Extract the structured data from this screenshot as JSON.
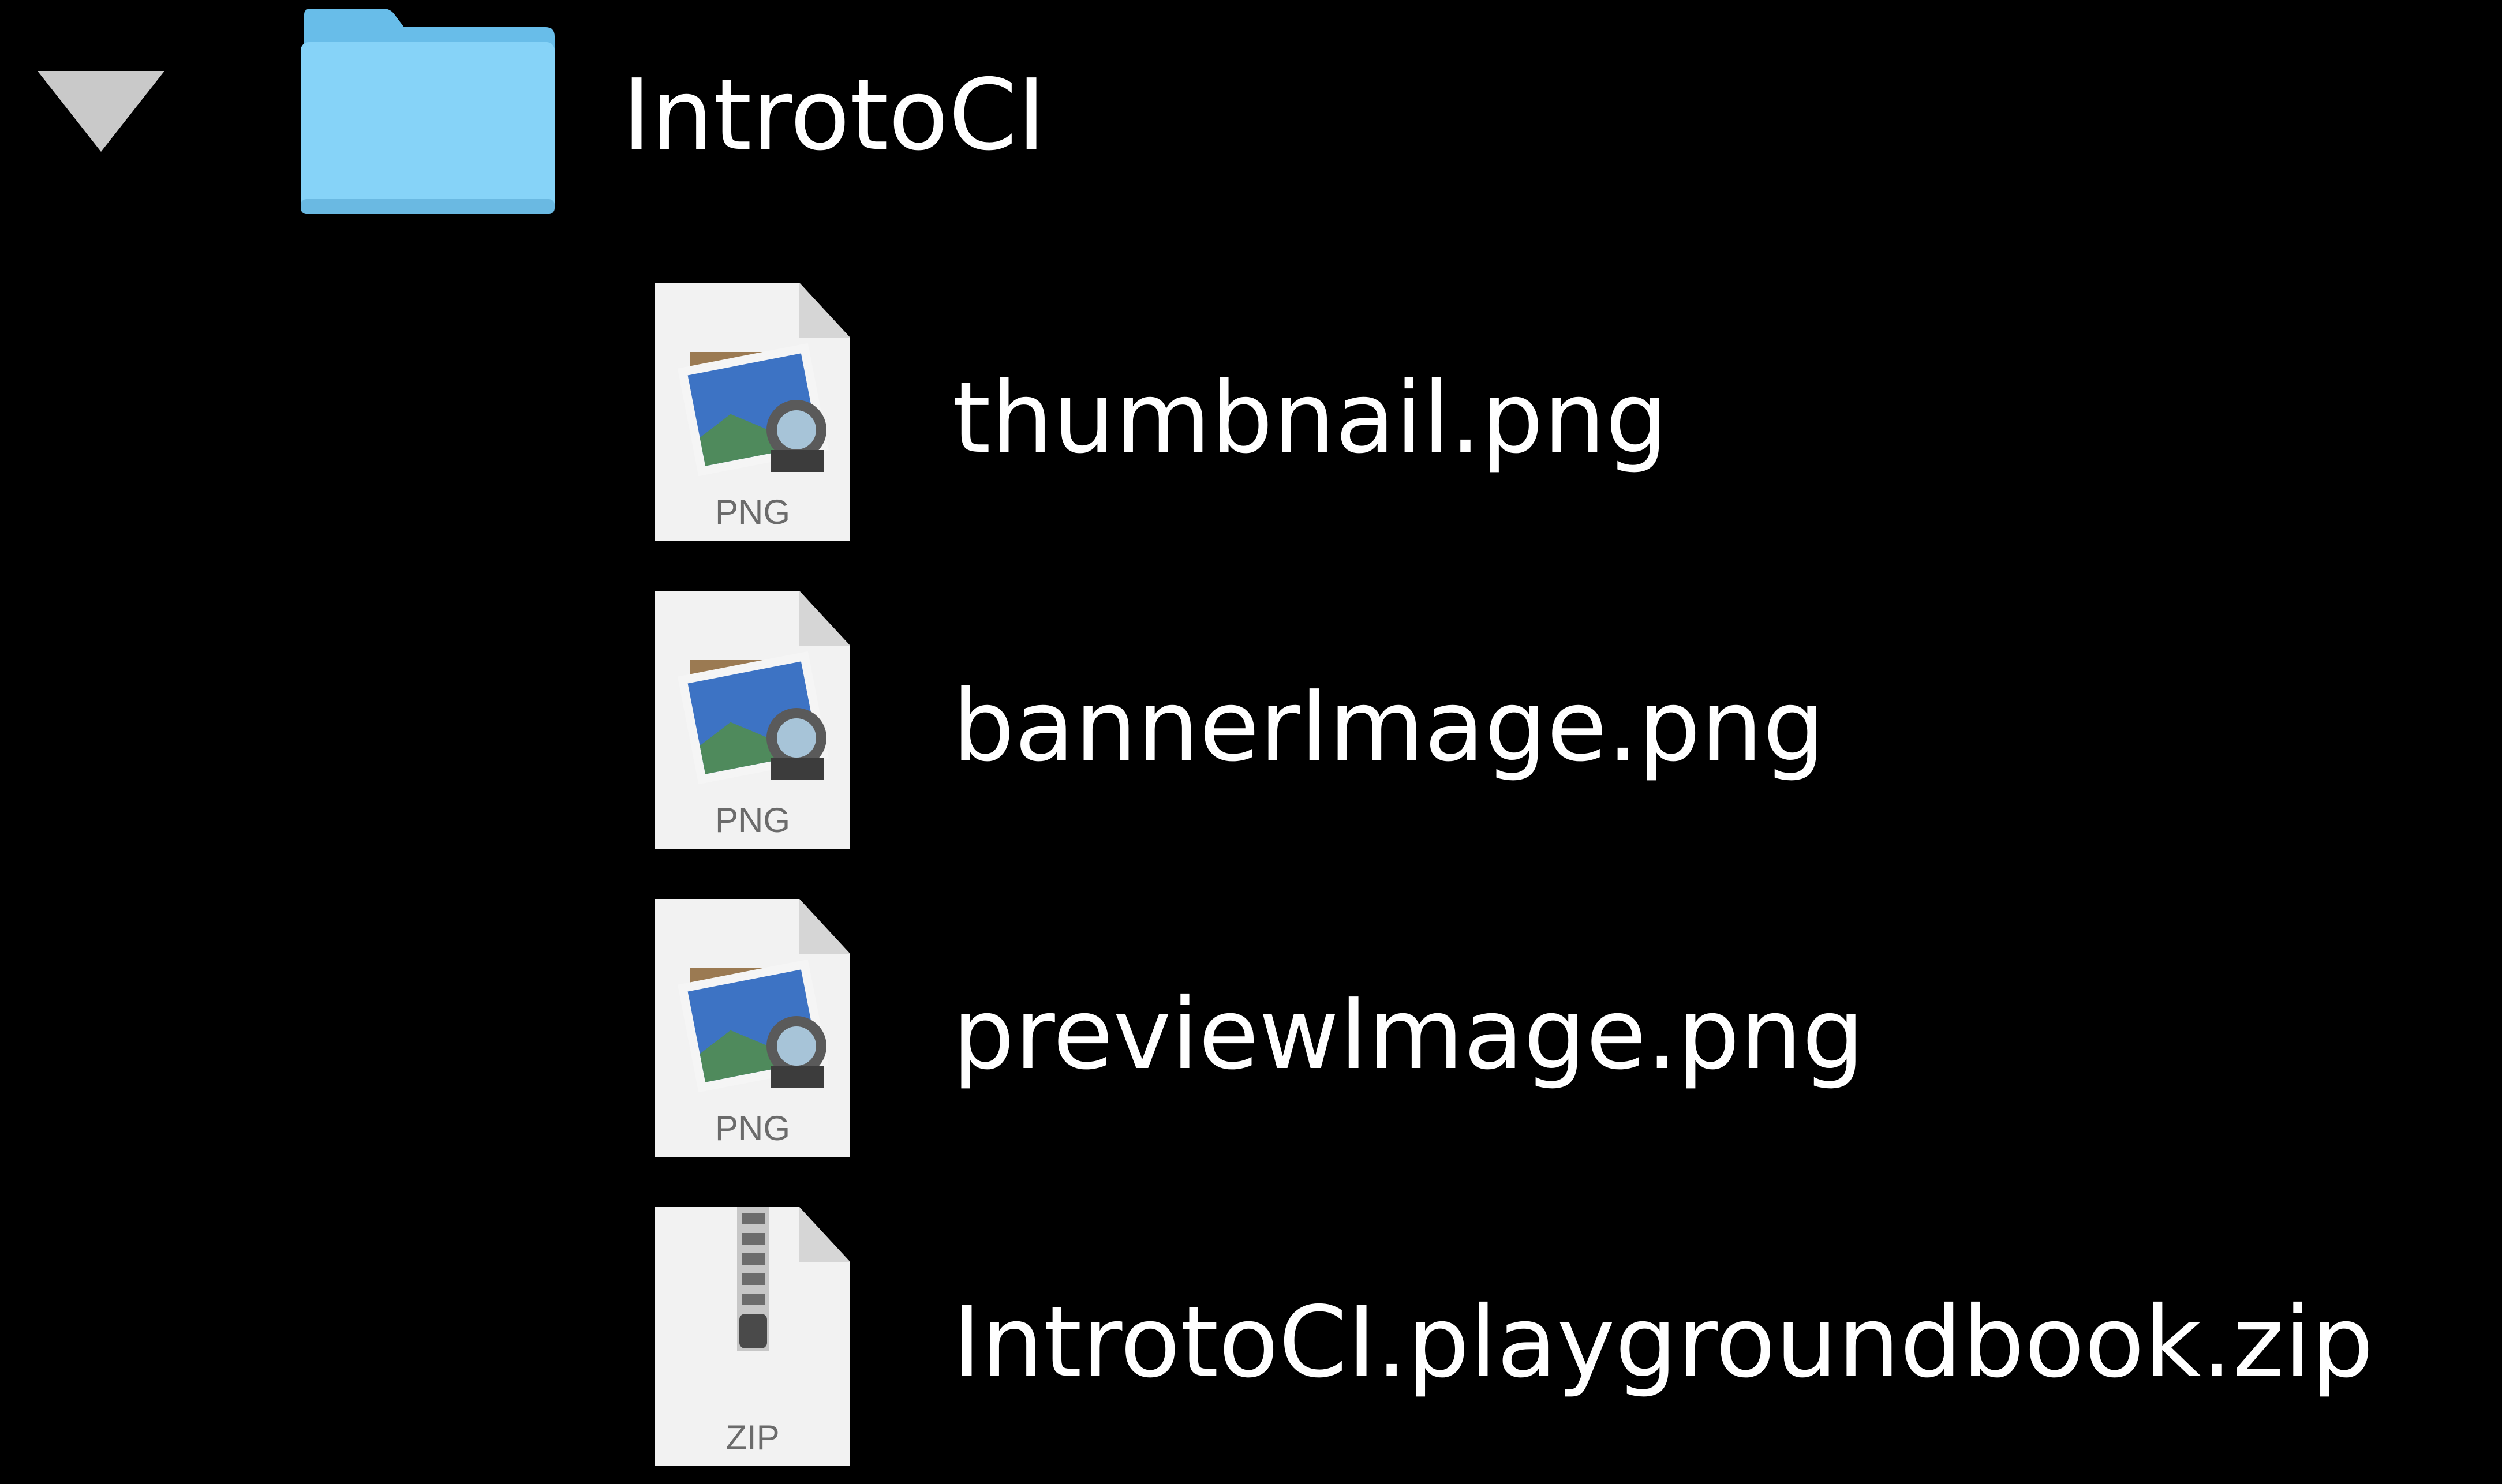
{
  "colors": {
    "background": "#000000",
    "text": "#ffffff",
    "folder": "#7ecbf4",
    "disclosure": "#c9c9c9"
  },
  "folder": {
    "name": "IntrotoCI",
    "icon": "folder-icon",
    "expanded": true
  },
  "files": [
    {
      "name": "thumbnail.png",
      "type_label": "PNG",
      "icon": "png-file-icon"
    },
    {
      "name": "bannerImage.png",
      "type_label": "PNG",
      "icon": "png-file-icon"
    },
    {
      "name": "previewImage.png",
      "type_label": "PNG",
      "icon": "png-file-icon"
    },
    {
      "name": "IntrotoCI.playgroundbook.zip",
      "type_label": "ZIP",
      "icon": "zip-file-icon"
    }
  ]
}
